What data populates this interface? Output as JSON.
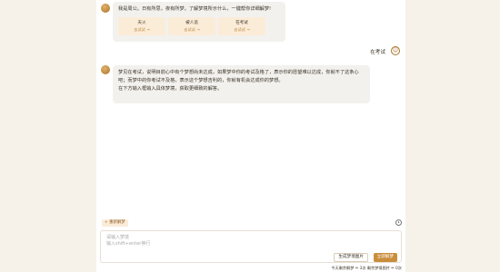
{
  "chat": {
    "intro": "我是周公。日有所思，夜有所梦。了解梦境所示什么，一键帮你详细解梦!",
    "cards": [
      {
        "title": "天火",
        "action": "去试试 →"
      },
      {
        "title": "被人追",
        "action": "去试试 →"
      },
      {
        "title": "在考试",
        "action": "去试试 →"
      }
    ],
    "user_message": "在考试",
    "reply": [
      "梦见在考试，说明目前心中有个梦想尚未达成，如果梦中你的考试及格了，表示你的愿望难以达成，你就不了这条心吧；而梦中的你考试不及格，表示这个梦想吉利的，你就有机会达成你的梦想。",
      "在下方输入框输入具体梦境，获取更细致的解答。"
    ]
  },
  "composer": {
    "reset_label": "+ 重新解梦",
    "placeholder_line1": "请输入梦境",
    "placeholder_line2": "输入shift+enter换行",
    "image_button": "生成梦境图片",
    "submit_button": "立即解梦"
  },
  "footer": {
    "status": "今天剩余解梦 ✏ 3次 剩余梦境图片 ✏ 0次"
  },
  "icons": {
    "bot_avatar": "zhougong-avatar-icon",
    "user_avatar": "user-avatar-icon",
    "history": "history-icon"
  }
}
